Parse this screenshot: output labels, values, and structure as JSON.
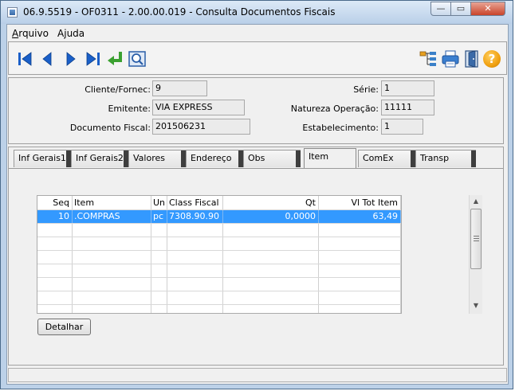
{
  "window": {
    "title": "06.9.5519 - OF0311 - 2.00.00.019 - Consulta Documentos Fiscais",
    "minimize_symbol": "—",
    "maximize_symbol": "▭",
    "close_symbol": "✕"
  },
  "menu": {
    "items": [
      {
        "label": "Arquivo",
        "accel_index": 0
      },
      {
        "label": "Ajuda",
        "accel_index": 1
      }
    ]
  },
  "toolbar": {
    "left_icons": [
      "first-record-icon",
      "previous-record-icon",
      "next-record-icon",
      "last-record-icon",
      "return-icon",
      "search-zoom-icon"
    ],
    "right_icons": [
      "tree-structure-icon",
      "print-icon",
      "exit-door-icon",
      "help-icon"
    ],
    "help_symbol": "?"
  },
  "form": {
    "cliente_fornec": {
      "label": "Cliente/Fornec:",
      "value": "9"
    },
    "emitente": {
      "label": "Emitente:",
      "value": "VIA EXPRESS"
    },
    "documento_fiscal": {
      "label": "Documento Fiscal:",
      "value": "201506231"
    },
    "serie": {
      "label": "Série:",
      "value": "1"
    },
    "natureza_operacao": {
      "label": "Natureza Operação:",
      "value": "11111"
    },
    "estabelecimento": {
      "label": "Estabelecimento:",
      "value": "1"
    }
  },
  "tabs": [
    {
      "label": "Inf Gerais1",
      "active": false
    },
    {
      "label": "Inf Gerais2",
      "active": false
    },
    {
      "label": "Valores",
      "active": false
    },
    {
      "label": "Endereço",
      "active": false
    },
    {
      "label": "Obs",
      "active": false
    },
    {
      "label": "Item",
      "active": true
    },
    {
      "label": "ComEx",
      "active": false
    },
    {
      "label": "Transp",
      "active": false
    }
  ],
  "grid": {
    "columns": [
      "Seq",
      "Item",
      "Un",
      "Class Fiscal",
      "Qt",
      "Vl Tot Item"
    ],
    "rows": [
      {
        "seq": "10",
        "item": ".COMPRAS",
        "un": "pc",
        "class_fiscal": "7308.90.90",
        "qt": "0,0000",
        "vl_tot_item": "63,49",
        "selected": true
      }
    ],
    "empty_rows": 7,
    "scroll_up": "▲",
    "scroll_down": "▼"
  },
  "buttons": {
    "detalhar": "Detalhar"
  },
  "colors": {
    "selection": "#3399ff",
    "help_button": "#f0a010",
    "nav_arrows": "#1a5fc8",
    "return_arrow": "#3aa030"
  }
}
